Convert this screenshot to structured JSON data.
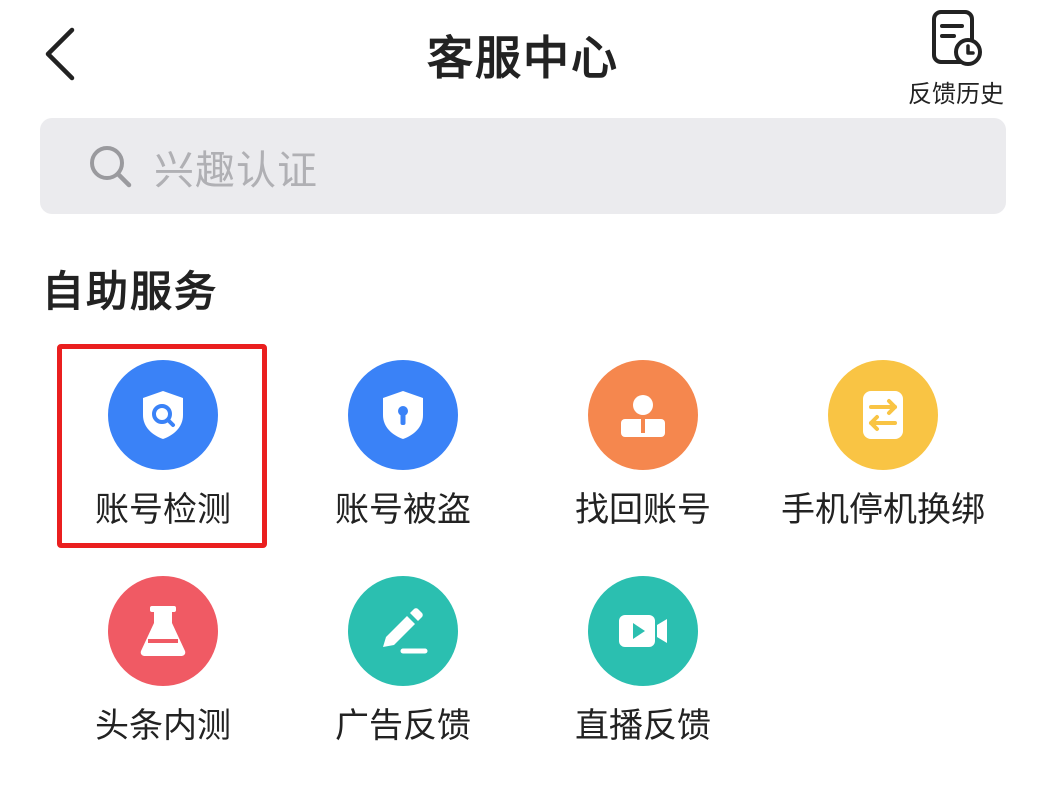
{
  "header": {
    "title": "客服中心",
    "history_label": "反馈历史"
  },
  "search": {
    "placeholder": "兴趣认证"
  },
  "section": {
    "title": "自助服务"
  },
  "services": [
    {
      "label": "账号检测",
      "icon": "shield-search-icon",
      "color": "#3a82f7",
      "highlighted": true
    },
    {
      "label": "账号被盗",
      "icon": "shield-lock-icon",
      "color": "#3a82f7",
      "highlighted": false
    },
    {
      "label": "找回账号",
      "icon": "user-badge-icon",
      "color": "#f5874e",
      "highlighted": false
    },
    {
      "label": "手机停机换绑",
      "icon": "swap-arrows-icon",
      "color": "#f9c444",
      "highlighted": false
    },
    {
      "label": "头条内测",
      "icon": "flask-icon",
      "color": "#f05a64",
      "highlighted": false
    },
    {
      "label": "广告反馈",
      "icon": "pencil-edit-icon",
      "color": "#2bbfb0",
      "highlighted": false
    },
    {
      "label": "直播反馈",
      "icon": "video-camera-icon",
      "color": "#2bbfb0",
      "highlighted": false
    }
  ],
  "colors": {
    "highlight_border": "#ea1f1f",
    "search_bg": "#ebebee"
  }
}
